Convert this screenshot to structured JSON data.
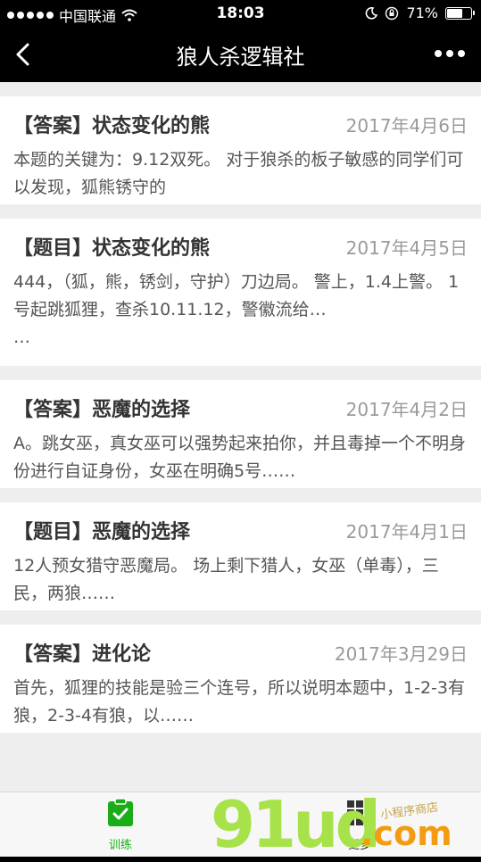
{
  "status_bar": {
    "carrier": "中国联通",
    "time": "18:03",
    "battery": "71%",
    "battery_level": 0.71
  },
  "nav": {
    "title": "狼人杀逻辑社"
  },
  "posts": [
    {
      "title": "【答案】状态变化的熊",
      "date": "2017年4月6日",
      "body": "本题的关键为：9.12双死。 对于狼杀的板子敏感的同学们可以发现，狐熊锈守的"
    },
    {
      "title": "【题目】状态变化的熊",
      "date": "2017年4月5日",
      "body": "444，（狐，熊，锈剑，守护）刀边局。 警上，1.4上警。 1号起跳狐狸，查杀10.11.12，警徽流给…\n…"
    },
    {
      "title": "【答案】恶魔的选择",
      "date": "2017年4月2日",
      "body": "A。跳女巫，真女巫可以强势起来拍你，并且毒掉一个不明身份进行自证身份，女巫在明确5号……"
    },
    {
      "title": "【题目】恶魔的选择",
      "date": "2017年4月1日",
      "body": "12人预女猎守恶魔局。 场上剩下猎人，女巫（单毒），三民，两狼……"
    },
    {
      "title": "【答案】进化论",
      "date": "2017年3月29日",
      "body": "首先，狐狸的技能是验三个连号，所以说明本题中，1-2-3有狼，2-3-4有狼，以……"
    }
  ],
  "tabbar": {
    "train_label": "训练",
    "more_label": "更多"
  },
  "watermark": {
    "main": "91ud",
    "com": ".com",
    "shop": "小程序商店"
  },
  "colors": {
    "accent": "#1aad19",
    "nav_bg": "#000000",
    "date_gray": "#9a9a9a"
  }
}
